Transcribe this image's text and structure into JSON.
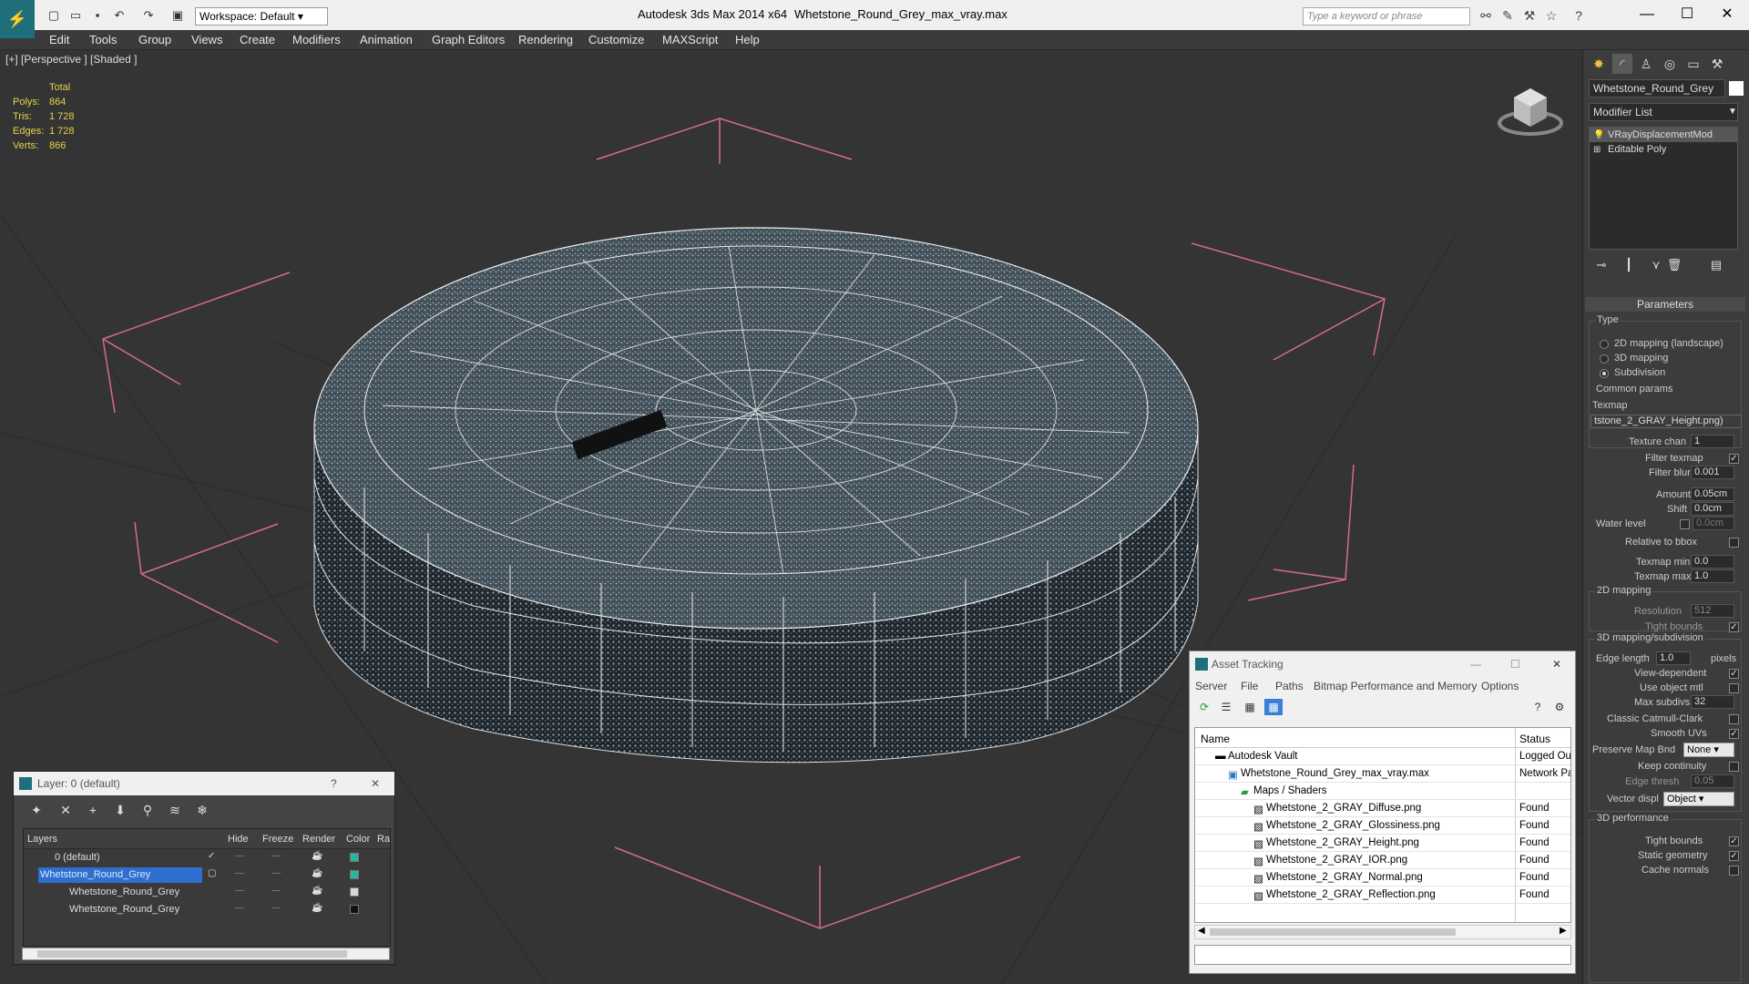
{
  "app": {
    "title": "Autodesk 3ds Max  2014 x64",
    "file": "Whetstone_Round_Grey_max_vray.max",
    "workspace": "Workspace: Default",
    "search_placeholder": "Type a keyword or phrase"
  },
  "menu": [
    "Edit",
    "Tools",
    "Group",
    "Views",
    "Create",
    "Modifiers",
    "Animation",
    "Graph Editors",
    "Rendering",
    "Customize",
    "MAXScript",
    "Help"
  ],
  "viewport": {
    "label": "[+] [Perspective ] [Shaded ]",
    "stats": {
      "header": "Total",
      "rows": [
        {
          "k": "Polys:",
          "v": "864"
        },
        {
          "k": "Tris:",
          "v": "1 728"
        },
        {
          "k": "Edges:",
          "v": "1 728"
        },
        {
          "k": "Verts:",
          "v": "866"
        }
      ]
    }
  },
  "command_panel": {
    "object_name": "Whetstone_Round_Grey",
    "object_color": "#ffffff",
    "modifier_list": "Modifier List",
    "stack": [
      "VRayDisplacementMod",
      "Editable Poly"
    ],
    "params_title": "Parameters",
    "type_group": "Type",
    "type_options": [
      "2D mapping (landscape)",
      "3D mapping",
      "Subdivision"
    ],
    "common_group": "Common params",
    "texmap_label": "Texmap",
    "texmap_value": "tstone_2_GRAY_Height.png)",
    "texture_chan_label": "Texture chan",
    "texture_chan": "1",
    "filter_texmap": "Filter texmap",
    "filter_blur_label": "Filter blur",
    "filter_blur": "0.001",
    "amount_label": "Amount",
    "amount": "0.05cm",
    "shift_label": "Shift",
    "shift": "0.0cm",
    "water_label": "Water level",
    "water": "0.0cm",
    "relative_bbox": "Relative to bbox",
    "texmap_min_label": "Texmap min",
    "texmap_min": "0.0",
    "texmap_max_label": "Texmap max",
    "texmap_max": "1.0",
    "map2d_group": "2D mapping",
    "resolution_label": "Resolution",
    "resolution": "512",
    "tight_bounds": "Tight bounds",
    "map3d_group": "3D mapping/subdivision",
    "edge_length_label": "Edge length",
    "edge_length": "1.0",
    "pixels": "pixels",
    "view_dependent": "View-dependent",
    "use_object_mtl": "Use object mtl",
    "max_subdivs_label": "Max subdivs",
    "max_subdivs": "32",
    "classic_catmull": "Classic Catmull-Clark",
    "smooth_uvs": "Smooth UVs",
    "preserve_map_label": "Preserve Map Bnd",
    "preserve_map": "None",
    "keep_continuity": "Keep continuity",
    "edge_thresh_label": "Edge thresh",
    "edge_thresh": "0.05",
    "vector_disp_label": "Vector displ",
    "vector_disp": "Object",
    "perf_group": "3D performance",
    "perf_tight": "Tight bounds",
    "static_geometry": "Static geometry",
    "cache_normals": "Cache normals"
  },
  "layer_window": {
    "title": "Layer: 0 (default)",
    "help": "?",
    "close": "✕",
    "headers": {
      "layers": "Layers",
      "hide": "Hide",
      "freeze": "Freeze",
      "render": "Render",
      "color": "Color",
      "radiosity": "Ra"
    },
    "rows": [
      {
        "name": "0 (default)",
        "color": "#2ab5a0"
      },
      {
        "name": "Whetstone_Round_Grey",
        "color": "#2ab5a0"
      },
      {
        "name": "Whetstone_Round_Grey",
        "color": "#d8d8d8"
      },
      {
        "name": "Whetstone_Round_Grey",
        "color": "#111111"
      }
    ]
  },
  "asset_window": {
    "title": "Asset Tracking",
    "menu": [
      "Server",
      "File",
      "Paths",
      "Bitmap Performance and Memory",
      "Options"
    ],
    "headers": {
      "name": "Name",
      "status": "Status"
    },
    "rows": [
      {
        "name": "Autodesk Vault",
        "status": "Logged Out"
      },
      {
        "name": "Whetstone_Round_Grey_max_vray.max",
        "status": "Network Path"
      },
      {
        "name": "Maps / Shaders",
        "status": ""
      },
      {
        "name": "Whetstone_2_GRAY_Diffuse.png",
        "status": "Found"
      },
      {
        "name": "Whetstone_2_GRAY_Glossiness.png",
        "status": "Found"
      },
      {
        "name": "Whetstone_2_GRAY_Height.png",
        "status": "Found"
      },
      {
        "name": "Whetstone_2_GRAY_IOR.png",
        "status": "Found"
      },
      {
        "name": "Whetstone_2_GRAY_Normal.png",
        "status": "Found"
      },
      {
        "name": "Whetstone_2_GRAY_Reflection.png",
        "status": "Found"
      }
    ]
  }
}
